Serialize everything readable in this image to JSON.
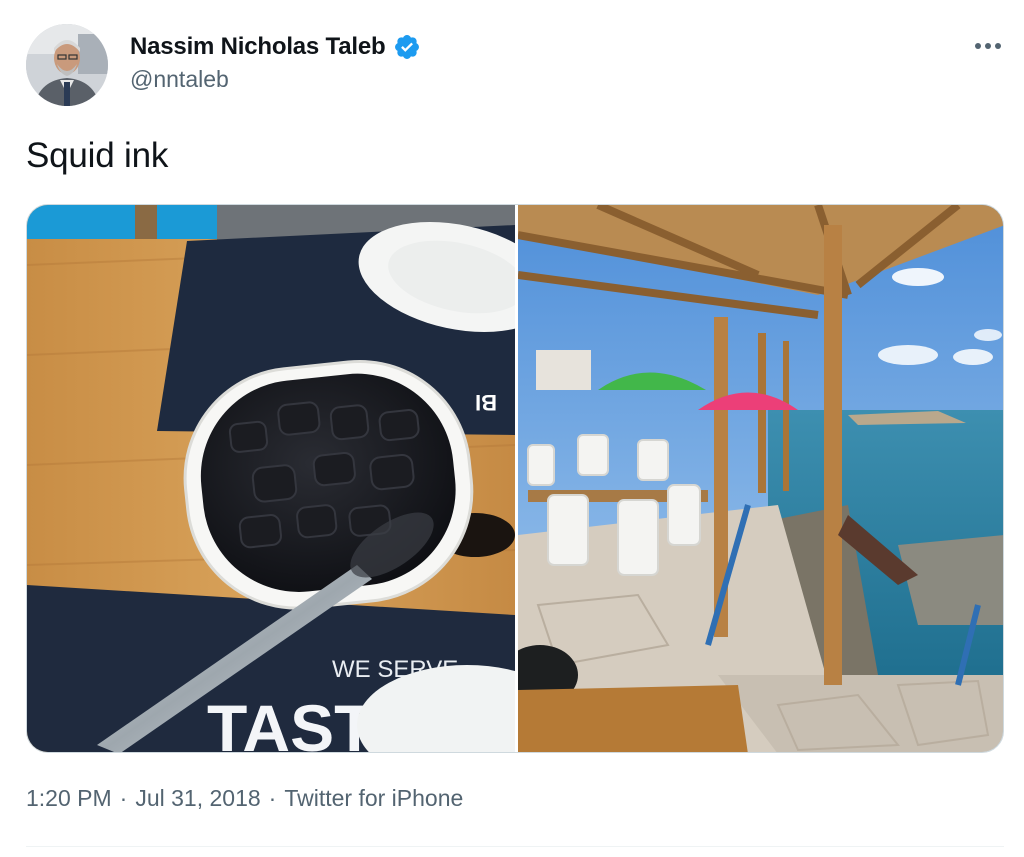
{
  "author": {
    "display_name": "Nassim Nicholas Taleb",
    "handle": "@nntaleb",
    "verified": true,
    "verified_color": "#1d9bf0"
  },
  "tweet": {
    "text": "Squid ink",
    "photos": [
      {
        "placemat_text_top": "WE SERVE",
        "placemat_text_big": "TASTY",
        "placemat_mirror_text": "BI"
      },
      {}
    ]
  },
  "meta": {
    "time": "1:20 PM",
    "date": "Jul 31, 2018",
    "source": "Twitter for iPhone",
    "separator": "·"
  },
  "icons": {
    "more": "more-dots-icon",
    "verified": "verified-badge-icon"
  }
}
